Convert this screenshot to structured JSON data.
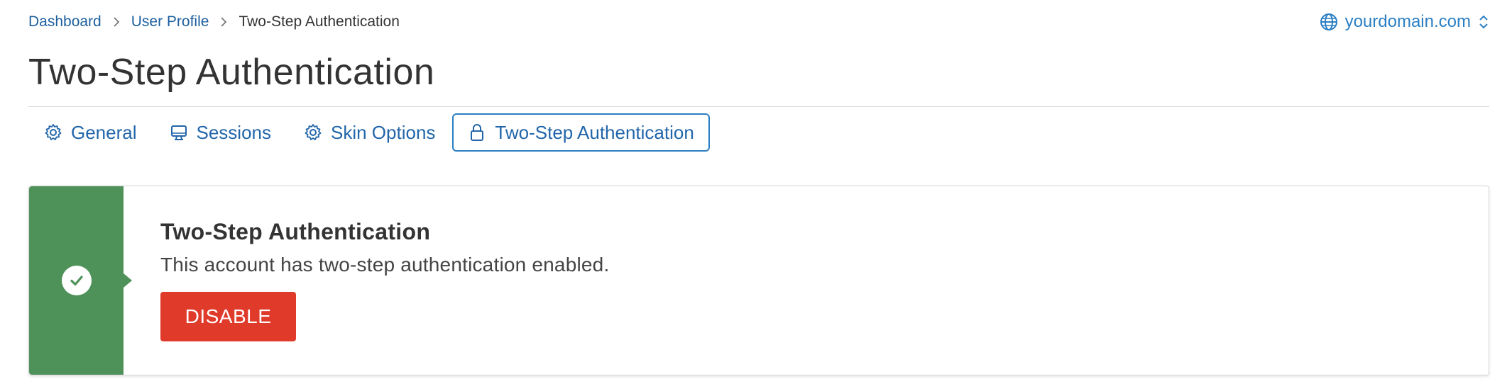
{
  "breadcrumb": {
    "items": [
      "Dashboard",
      "User Profile",
      "Two-Step Authentication"
    ]
  },
  "domain_selector": {
    "value": "yourdomain.com",
    "icon": "globe-icon",
    "toggle_icon": "chevron-updown-icon"
  },
  "page": {
    "title": "Two-Step Authentication"
  },
  "tabs": [
    {
      "label": "General",
      "icon": "gear-icon",
      "active": false
    },
    {
      "label": "Sessions",
      "icon": "monitor-icon",
      "active": false
    },
    {
      "label": "Skin Options",
      "icon": "gear-icon",
      "active": false
    },
    {
      "label": "Two-Step Authentication",
      "icon": "lock-icon",
      "active": true
    }
  ],
  "status_card": {
    "title": "Two-Step Authentication",
    "message": "This account has two-step authentication enabled.",
    "button_label": "DISABLE",
    "status_icon": "check-icon"
  },
  "colors": {
    "link": "#1d5f9e",
    "accent": "#2c7fc3",
    "success": "#4e9159",
    "danger": "#e03a2b",
    "text": "#333333"
  }
}
